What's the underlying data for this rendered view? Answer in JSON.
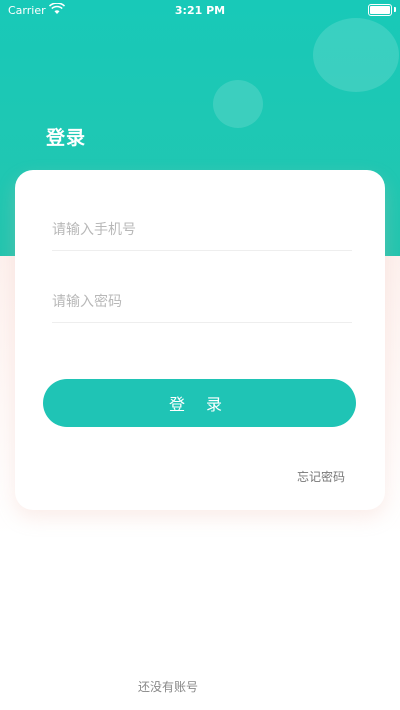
{
  "status_bar": {
    "carrier": "Carrier",
    "time": "3:21 PM"
  },
  "page": {
    "title": "登录"
  },
  "form": {
    "phone_placeholder": "请输入手机号",
    "password_placeholder": "请输入密码",
    "login_button": "登 录",
    "forgot_password": "忘记密码"
  },
  "footer": {
    "register_prompt": "还没有账号"
  },
  "colors": {
    "accent": "#1fc4b5",
    "header": "#18c9b8"
  }
}
